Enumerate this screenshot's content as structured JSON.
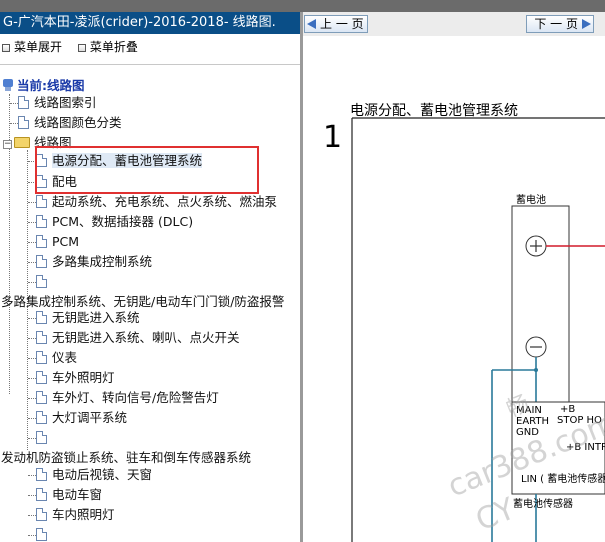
{
  "window": {
    "title": "G-广汽本田-凌派(crider)-2016-2018- 线路图."
  },
  "menu": {
    "expand_label": "菜单展开",
    "collapse_label": "菜单折叠"
  },
  "tree": {
    "root_label": "当前:线路图",
    "items": [
      {
        "label": "线路图索引"
      },
      {
        "label": "线路图颜色分类"
      },
      {
        "label": "线路图"
      },
      {
        "label": "电源分配、蓄电池管理系统"
      },
      {
        "label": "配电"
      },
      {
        "label": "起动系统、充电系统、点火系统、燃油泵"
      },
      {
        "label": "PCM、数据插接器 (DLC)"
      },
      {
        "label": "PCM"
      },
      {
        "label": "多路集成控制系统"
      },
      {
        "label": ""
      },
      {
        "label": "多路集成控制系统、无钥匙/电动车门门锁/防盗报警"
      },
      {
        "label": "无钥匙进入系统"
      },
      {
        "label": "无钥匙进入系统、喇叭、点火开关"
      },
      {
        "label": "仪表"
      },
      {
        "label": "车外照明灯"
      },
      {
        "label": "车外灯、转向信号/危险警告灯"
      },
      {
        "label": "大灯调平系统"
      },
      {
        "label": ""
      },
      {
        "label": "发动机防盗锁止系统、驻车和倒车传感器系统"
      },
      {
        "label": "电动后视镜、天窗"
      },
      {
        "label": "电动车窗"
      },
      {
        "label": "车内照明灯"
      },
      {
        "label": ""
      }
    ]
  },
  "nav": {
    "prev_label": "上 一 页",
    "next_label": "下 一 页"
  },
  "diagram": {
    "title": "电源分配、蓄电池管理系统",
    "page_number": "1",
    "battery_label": "蓄电池",
    "plus_symbol": "+",
    "minus_symbol": "−",
    "main_label": "MAIN",
    "earth_label": "EARTH",
    "gnd_label": "GND",
    "b_label": "+B",
    "stop_label": "STOP HO",
    "b_intr_label": "+B INTR",
    "lin_label": "LIN ( 蓄电池传感器",
    "sensor_label": "蓄电池传感器",
    "watermark_1": "畅",
    "watermark_2": "car388.com",
    "watermark_3": "CY"
  },
  "colors": {
    "titlebar": "#0a4e87",
    "highlight_box": "#e03030",
    "wire_red": "#d21a2a",
    "wire_teal": "#2a7a9a"
  }
}
